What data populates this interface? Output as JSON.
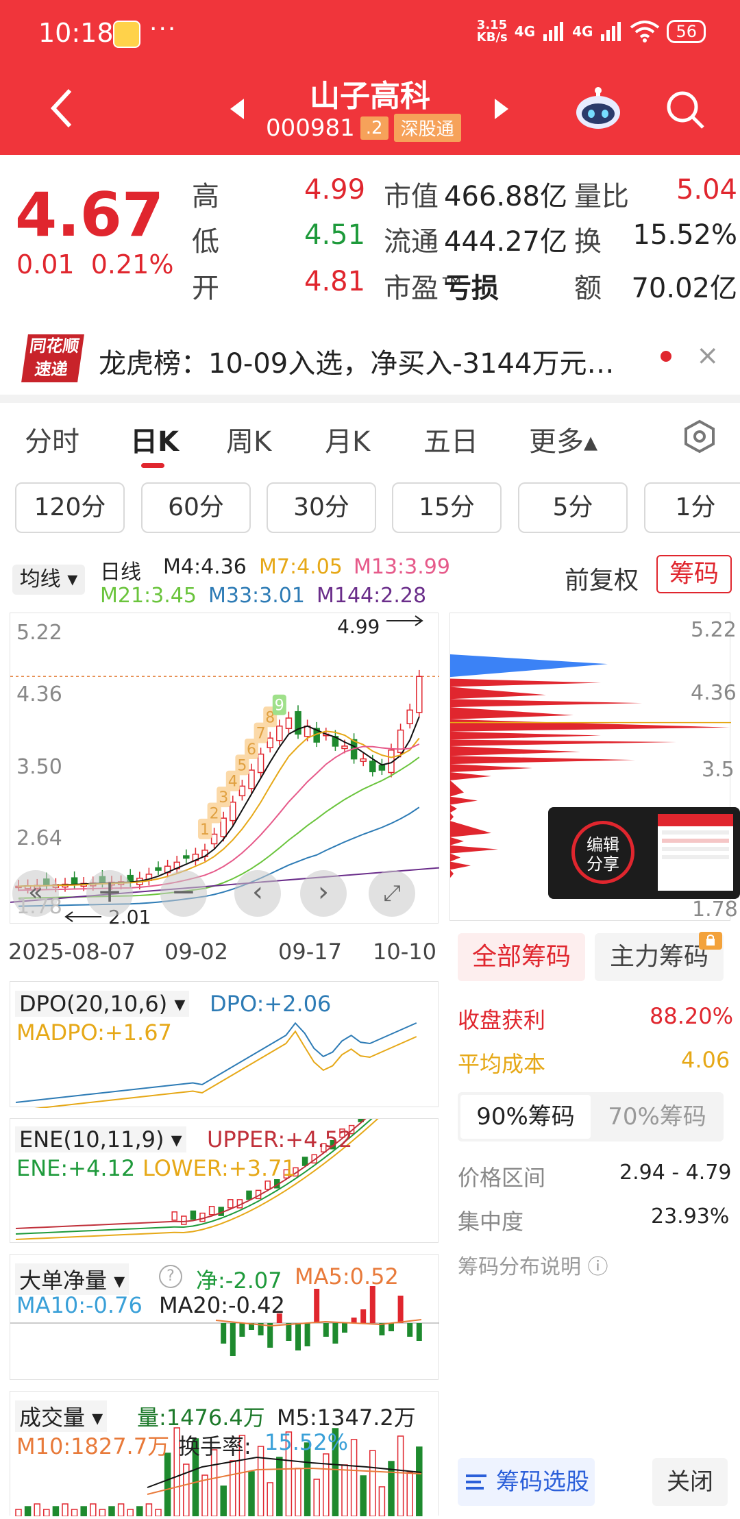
{
  "status": {
    "time": "10:18",
    "dots": "···",
    "speed": "3.15\nKB/s",
    "net1": "4G",
    "net2": "4G",
    "battery": "56"
  },
  "header": {
    "title": "山子高科",
    "code": "000981",
    "tag1": ".2",
    "tag2": "深股通"
  },
  "quote": {
    "price": "4.67",
    "change": "0.01",
    "change_pct": "0.21%",
    "rows": [
      {
        "l1": "高",
        "v1": "4.99",
        "l2": "市值",
        "v2": "466.88亿",
        "l3": "量比",
        "v3": "5.04"
      },
      {
        "l1": "低",
        "v1": "4.51",
        "l2": "流通",
        "v2": "444.27亿",
        "l3": "换",
        "v3": "15.52%"
      },
      {
        "l1": "开",
        "v1": "4.81",
        "l2": "市盈™",
        "v2": "亏损",
        "l3": "额",
        "v3": "70.02亿"
      }
    ]
  },
  "news": {
    "logo_top": "同花顺",
    "logo_bottom": "速递",
    "text": "龙虎榜：10-09入选，净买入-3144万元…",
    "close": "×"
  },
  "tabs": [
    "分时",
    "日K",
    "周K",
    "月K",
    "五日",
    "更多▴"
  ],
  "periods": [
    "120分",
    "60分",
    "30分",
    "15分",
    "5分",
    "1分"
  ],
  "kline": {
    "ma_select": "均线 ▾",
    "label": "日线",
    "m4": "M4:4.36",
    "m7": "M7:4.05",
    "m13": "M13:3.99",
    "m21": "M21:3.45",
    "m33": "M33:3.01",
    "m144": "M144:2.28",
    "adjust": "前复权",
    "chip_btn": "筹码",
    "y_ticks": [
      "5.22",
      "4.36",
      "3.50",
      "2.64",
      "1.78"
    ],
    "high_mark": "4.99",
    "low_mark": "2.01",
    "x_ticks": [
      "2025-08-07",
      "09-02",
      "09-17",
      "10-10"
    ],
    "nine_labels": [
      "1",
      "2",
      "3",
      "4",
      "5",
      "6",
      "7",
      "8",
      "9"
    ]
  },
  "chip_panel": {
    "y_ticks": [
      "5.22",
      "4.36",
      "3.5",
      "1.78"
    ],
    "tab_all": "全部筹码",
    "tab_main": "主力筹码",
    "profit_label": "收盘获利",
    "profit_value": "88.20%",
    "cost_label": "平均成本",
    "cost_value": "4.06",
    "seg90": "90%筹码",
    "seg70": "70%筹码",
    "range_label": "价格区间",
    "range_value": "2.94 - 4.79",
    "conc_label": "集中度",
    "conc_value": "23.93%",
    "help": "筹码分布说明 ⓘ",
    "select_btn": "筹码选股",
    "close_btn": "关闭",
    "share_label1": "编辑",
    "share_label2": "分享"
  },
  "dpo": {
    "name": "DPO(20,10,6) ▾",
    "dpo": "DPO:+2.06",
    "madpo": "MADPO:+1.67"
  },
  "ene": {
    "name": "ENE(10,11,9) ▾",
    "upper": "UPPER:+4.52",
    "ene": "ENE:+4.12",
    "lower": "LOWER:+3.71"
  },
  "bigorder": {
    "name": "大单净量 ▾",
    "net": "净:-2.07",
    "ma5": "MA5:0.52",
    "ma10": "MA10:-0.76",
    "ma20": "MA20:-0.42"
  },
  "volume": {
    "name": "成交量 ▾",
    "vol": "量:1476.4万",
    "m5": "M5:1347.2万",
    "m10": "M10:1827.7万",
    "turnover_label": "换手率:",
    "turnover": "15.52%"
  }
}
